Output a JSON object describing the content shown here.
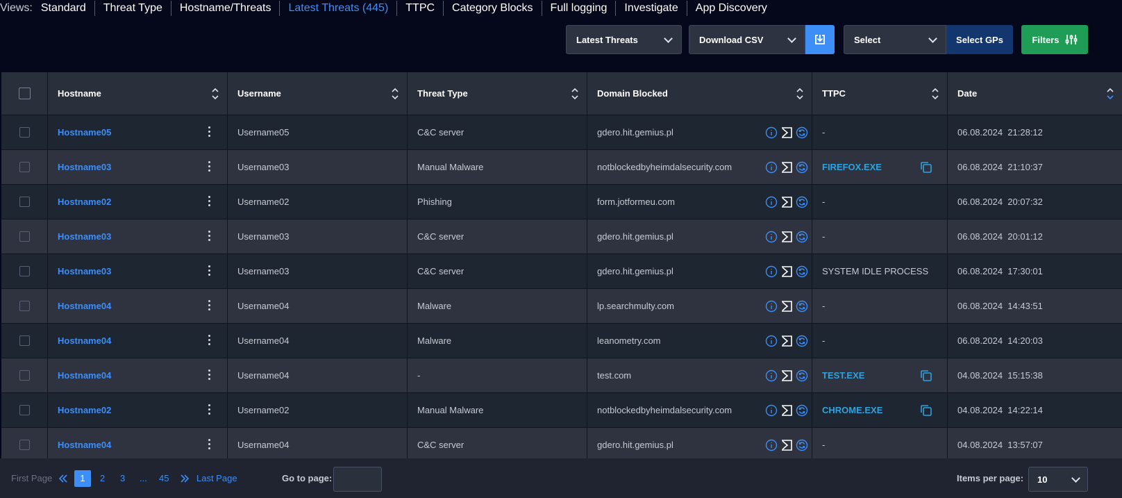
{
  "views": {
    "label": "Views:",
    "items": [
      {
        "label": "Standard",
        "active": false
      },
      {
        "label": "Threat Type",
        "active": false
      },
      {
        "label": "Hostname/Threats",
        "active": false
      },
      {
        "label": "Latest Threats (445)",
        "active": true
      },
      {
        "label": "TTPC",
        "active": false
      },
      {
        "label": "Category Blocks",
        "active": false
      },
      {
        "label": "Full logging",
        "active": false
      },
      {
        "label": "Investigate",
        "active": false
      },
      {
        "label": "App Discovery",
        "active": false
      }
    ]
  },
  "toolbar": {
    "report_select": "Latest Threats",
    "download_select": "Download CSV",
    "gp_select": "Select",
    "select_gps_label": "Select GPs",
    "filters_label": "Filters"
  },
  "table": {
    "headers": [
      "Hostname",
      "Username",
      "Threat Type",
      "Domain Blocked",
      "TTPC",
      "Date"
    ],
    "rows": [
      {
        "hostname": "Hostname05",
        "username": "Username05",
        "threat": "C&C server",
        "domain": "gdero.hit.gemius.pl",
        "ttpc": "-",
        "ttpc_link": false,
        "date": "06.08.2024  21:28:12"
      },
      {
        "hostname": "Hostname03",
        "username": "Username03",
        "threat": "Manual Malware",
        "domain": "notblockedbyheimdalsecurity.com",
        "ttpc": "FIREFOX.EXE",
        "ttpc_link": true,
        "date": "06.08.2024  21:10:37"
      },
      {
        "hostname": "Hostname02",
        "username": "Username02",
        "threat": "Phishing",
        "domain": "form.jotformeu.com",
        "ttpc": "-",
        "ttpc_link": false,
        "date": "06.08.2024  20:07:32"
      },
      {
        "hostname": "Hostname03",
        "username": "Username03",
        "threat": "C&C server",
        "domain": "gdero.hit.gemius.pl",
        "ttpc": "-",
        "ttpc_link": false,
        "date": "06.08.2024  20:01:12"
      },
      {
        "hostname": "Hostname03",
        "username": "Username03",
        "threat": "C&C server",
        "domain": "gdero.hit.gemius.pl",
        "ttpc": "SYSTEM IDLE PROCESS",
        "ttpc_link": false,
        "date": "06.08.2024  17:30:01"
      },
      {
        "hostname": "Hostname04",
        "username": "Username04",
        "threat": "Malware",
        "domain": "lp.searchmulty.com",
        "ttpc": "-",
        "ttpc_link": false,
        "date": "06.08.2024  14:43:51"
      },
      {
        "hostname": "Hostname04",
        "username": "Username04",
        "threat": "Malware",
        "domain": "leanometry.com",
        "ttpc": "-",
        "ttpc_link": false,
        "date": "06.08.2024  14:20:03"
      },
      {
        "hostname": "Hostname04",
        "username": "Username04",
        "threat": "-",
        "domain": "test.com",
        "ttpc": "TEST.EXE",
        "ttpc_link": true,
        "date": "04.08.2024  15:15:38"
      },
      {
        "hostname": "Hostname02",
        "username": "Username02",
        "threat": "Manual Malware",
        "domain": "notblockedbyheimdalsecurity.com",
        "ttpc": "CHROME.EXE",
        "ttpc_link": true,
        "date": "04.08.2024  14:22:14"
      },
      {
        "hostname": "Hostname04",
        "username": "Username04",
        "threat": "C&C server",
        "domain": "gdero.hit.gemius.pl",
        "ttpc": "-",
        "ttpc_link": false,
        "date": "04.08.2024  13:57:07"
      }
    ]
  },
  "pagination": {
    "first_label": "First Page",
    "pages": [
      "1",
      "2",
      "3",
      "...",
      "45"
    ],
    "current": "1",
    "last_label": "Last Page",
    "goto_label": "Go to page:",
    "goto_value": "",
    "items_label": "Items per page:",
    "items_value": "10"
  },
  "colors": {
    "accent": "#3d8ef7",
    "link_ttpc": "#2fa3de",
    "filters": "#1f9d57",
    "select_gps": "#12366d"
  }
}
